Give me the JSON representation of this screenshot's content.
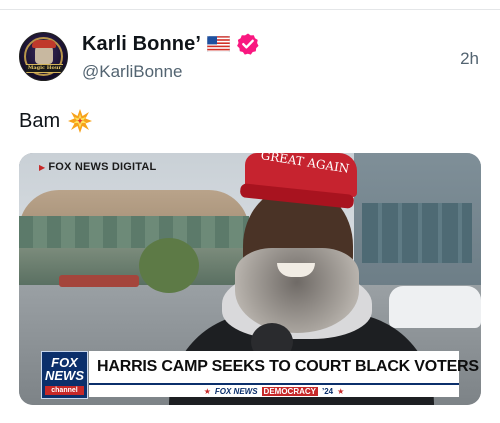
{
  "post": {
    "author": {
      "display_name": "Karli Bonne’",
      "handle": "@KarliBonne",
      "avatar_text": "Magic Hour",
      "flag_icon": "us-flag-icon",
      "verified_icon": "verified-badge-icon",
      "verified_color": "#f91880"
    },
    "timestamp": "2h",
    "text": "Bam",
    "emoji": "collision-icon"
  },
  "media": {
    "watermark": "FOX NEWS DIGITAL",
    "hat_text": "GREAT AGAIN",
    "logo": {
      "line1": "FOX",
      "line2": "NEWS",
      "line3": "channel"
    },
    "headline": "HARRIS CAMP SEEKS TO COURT BLACK VOTERS",
    "subbar": {
      "brand": "FOX NEWS",
      "tag": "DEMOCRACY",
      "year": "’24"
    }
  },
  "colors": {
    "text_primary": "#0f1419",
    "text_secondary": "#536471",
    "fox_blue": "#0b2f6b",
    "fox_red": "#c62828"
  }
}
